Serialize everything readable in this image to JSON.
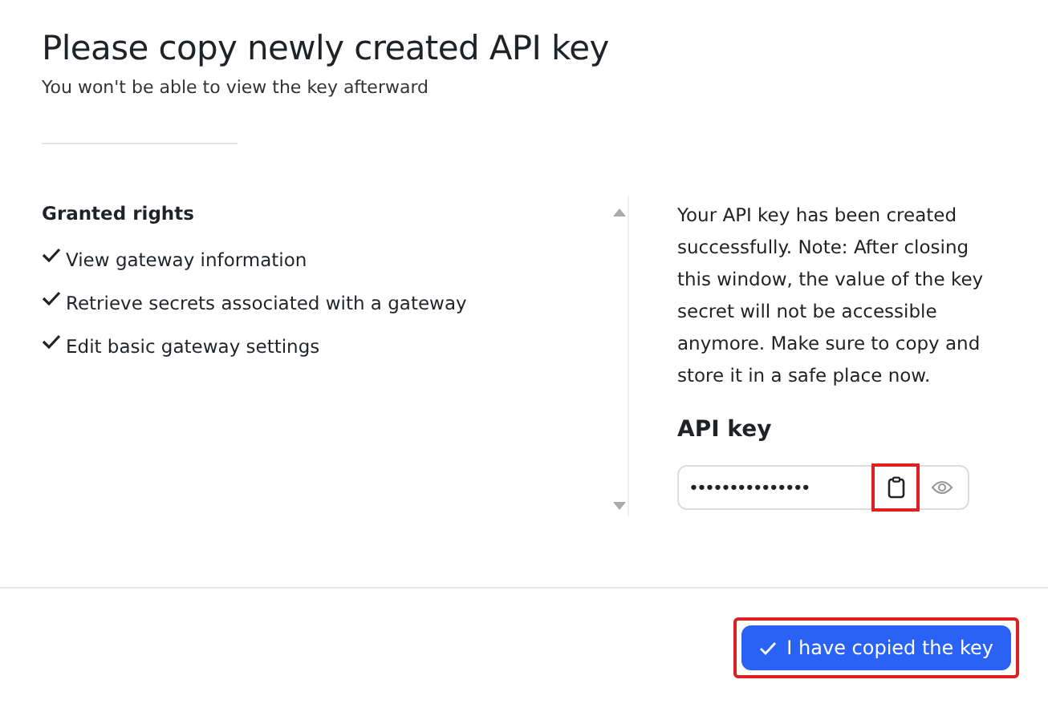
{
  "title": "Please copy newly created API key",
  "subtitle": "You won't be able to view the key afterward",
  "rights": {
    "heading": "Granted rights",
    "items": [
      {
        "label": "View gateway information",
        "checked": true
      },
      {
        "label": "Retrieve secrets associated with a gateway",
        "checked": true
      },
      {
        "label": "Edit basic gateway settings",
        "checked": true
      }
    ]
  },
  "notice": "Your API key has been created successfully. Note: After closing this window, the value of the key secret will not be accessible anymore. Make sure to copy and store it in a safe place now.",
  "api_key": {
    "label": "API key",
    "value": "•••••••••••••••",
    "copy_highlighted": true
  },
  "confirm_button": {
    "label": "I have copied the key",
    "highlighted": true
  }
}
